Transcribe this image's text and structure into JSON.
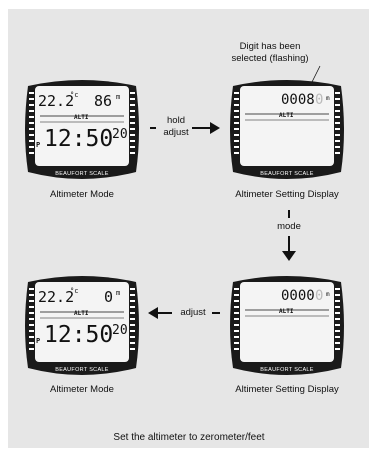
{
  "note": {
    "line1": "Digit has been",
    "line2": "selected (flashing)"
  },
  "arrows": {
    "hold_line1": "hold",
    "hold_line2": "adjust",
    "mode": "mode",
    "adjust": "adjust"
  },
  "captions": {
    "tl": "Altimeter Mode",
    "tr": "Altimeter Setting Display",
    "bl": "Altimeter Mode",
    "br": "Altimeter Setting Display"
  },
  "watch_tl": {
    "temp": "22.2",
    "temp_unit": "°c",
    "altitude": "86",
    "alt_unit": "m",
    "alti": "ALTI",
    "pm": "P",
    "time": "12:50",
    "seconds": "20",
    "brand": "BEAUFORT SCALE"
  },
  "watch_tr": {
    "digits": "0008",
    "flash_digit": "0",
    "alt_unit": "m",
    "alti": "ALTI",
    "brand": "BEAUFORT SCALE"
  },
  "watch_bl": {
    "temp": "22.2",
    "temp_unit": "°c",
    "altitude": "0",
    "alt_unit": "m",
    "alti": "ALTI",
    "pm": "P",
    "time": "12:50",
    "seconds": "20",
    "brand": "BEAUFORT SCALE"
  },
  "watch_br": {
    "digits": "0000",
    "flash_digit": "0",
    "alt_unit": "m",
    "alti": "ALTI",
    "brand": "BEAUFORT SCALE"
  },
  "footer": "Set the altimeter to zerometer/feet",
  "colors": {
    "panel": "#e6e6e6",
    "bezel": "#1a1a1a",
    "lcd": "#f4f4f4",
    "text": "#111111"
  }
}
